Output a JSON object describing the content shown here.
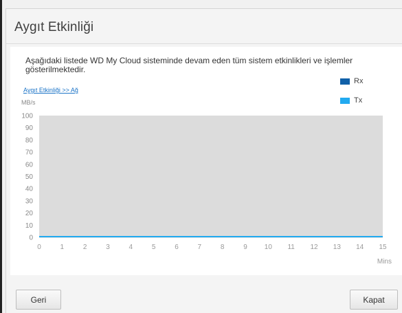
{
  "dialog": {
    "title": "Aygıt Etkinliği",
    "description": "Aşağıdaki listede WD My Cloud  sisteminde devam eden tüm sistem etkinlikleri ve işlemler gösterilmektedir.",
    "link": "Aygıt Etkinliği >> Ağ",
    "back_label": "Geri",
    "close_label": "Kapat"
  },
  "legend": [
    {
      "label": "Rx",
      "color": "#1060a8"
    },
    {
      "label": "Tx",
      "color": "#22aaf0"
    }
  ],
  "chart_data": {
    "type": "line",
    "ylabel": "MB/s",
    "xlabel": "Mins",
    "ylim": [
      0,
      100
    ],
    "xlim": [
      0,
      15
    ],
    "yticks": [
      100,
      90,
      80,
      70,
      60,
      50,
      40,
      30,
      20,
      10,
      0
    ],
    "xticks": [
      0,
      1,
      2,
      3,
      4,
      5,
      6,
      7,
      8,
      9,
      10,
      11,
      12,
      13,
      14,
      15
    ],
    "grid": false,
    "series": [
      {
        "name": "Rx",
        "color": "#1060a8",
        "x": [
          0,
          15
        ],
        "y": [
          0,
          0
        ]
      },
      {
        "name": "Tx",
        "color": "#22aaf0",
        "x": [
          0,
          15
        ],
        "y": [
          0,
          0
        ]
      }
    ]
  }
}
